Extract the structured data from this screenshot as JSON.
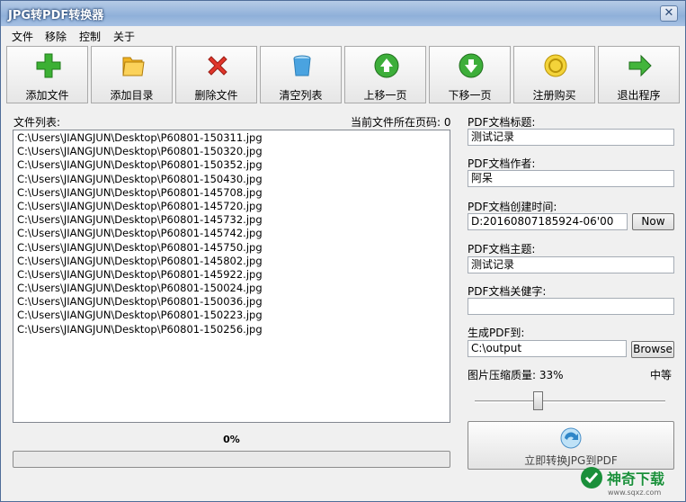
{
  "window": {
    "title": "JPG转PDF转换器",
    "close_glyph": "✕"
  },
  "menu": [
    "文件",
    "移除",
    "控制",
    "关于"
  ],
  "toolbar": [
    {
      "label": "添加文件",
      "icon": "add-plus-icon"
    },
    {
      "label": "添加目录",
      "icon": "folder-icon"
    },
    {
      "label": "删除文件",
      "icon": "delete-x-icon"
    },
    {
      "label": "清空列表",
      "icon": "bin-icon"
    },
    {
      "label": "上移一页",
      "icon": "arrow-up-icon"
    },
    {
      "label": "下移一页",
      "icon": "arrow-down-icon"
    },
    {
      "label": "注册购买",
      "icon": "coin-icon"
    },
    {
      "label": "退出程序",
      "icon": "exit-arrow-icon"
    }
  ],
  "filelist": {
    "label": "文件列表:",
    "page_info": "当前文件所在页码: 0",
    "files": [
      "C:\\Users\\JIANGJUN\\Desktop\\P60801-150311.jpg",
      "C:\\Users\\JIANGJUN\\Desktop\\P60801-150320.jpg",
      "C:\\Users\\JIANGJUN\\Desktop\\P60801-150352.jpg",
      "C:\\Users\\JIANGJUN\\Desktop\\P60801-150430.jpg",
      "C:\\Users\\JIANGJUN\\Desktop\\P60801-145708.jpg",
      "C:\\Users\\JIANGJUN\\Desktop\\P60801-145720.jpg",
      "C:\\Users\\JIANGJUN\\Desktop\\P60801-145732.jpg",
      "C:\\Users\\JIANGJUN\\Desktop\\P60801-145742.jpg",
      "C:\\Users\\JIANGJUN\\Desktop\\P60801-145750.jpg",
      "C:\\Users\\JIANGJUN\\Desktop\\P60801-145802.jpg",
      "C:\\Users\\JIANGJUN\\Desktop\\P60801-145922.jpg",
      "C:\\Users\\JIANGJUN\\Desktop\\P60801-150024.jpg",
      "C:\\Users\\JIANGJUN\\Desktop\\P60801-150036.jpg",
      "C:\\Users\\JIANGJUN\\Desktop\\P60801-150223.jpg",
      "C:\\Users\\JIANGJUN\\Desktop\\P60801-150256.jpg"
    ]
  },
  "progress": {
    "label": "0%",
    "value": 0
  },
  "pdf": {
    "title_label": "PDF文档标题:",
    "title_value": "测试记录",
    "author_label": "PDF文档作者:",
    "author_value": "阿呆",
    "created_label": "PDF文档创建时间:",
    "created_value": "D:20160807185924-06'00",
    "now_button": "Now",
    "subject_label": "PDF文档主题:",
    "subject_value": "测试记录",
    "keywords_label": "PDF文档关健字:",
    "keywords_value": "",
    "output_label": "生成PDF到:",
    "output_value": "C:\\output",
    "browse_button": "Browse",
    "quality_label": "图片压缩质量: 33%",
    "quality_level": "中等",
    "quality_value": 0.33,
    "convert_button": "立即转换JPG到PDF"
  },
  "watermark": {
    "text": "神奇下载",
    "url": "www.sqxz.com"
  },
  "colors": {
    "progress": "#37b34a",
    "watermark": "#1a8f3a",
    "title_bar": "#8fb0d9"
  }
}
